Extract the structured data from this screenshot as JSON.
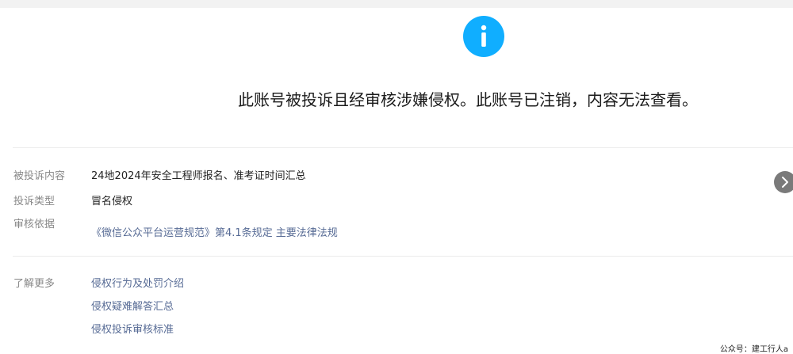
{
  "headline": "此账号被投诉且经审核涉嫌侵权。此账号已注销，内容无法查看。",
  "details": {
    "complaint_content_label": "被投诉内容",
    "complaint_content_value": "24地2024年安全工程师报名、准考证时间汇总",
    "complaint_type_label": "投诉类型",
    "complaint_type_value": "冒名侵权",
    "review_basis_label": "审核依据",
    "review_basis_link": "《微信公众平台运营规范》第4.1条规定 主要法律法规"
  },
  "learn_more": {
    "label": "了解更多",
    "links": [
      "侵权行为及处罚介绍",
      "侵权疑难解答汇总",
      "侵权投诉审核标准"
    ]
  },
  "footer": {
    "credit": "公众号：建工行人a"
  },
  "icons": {
    "info": "info-icon",
    "next": "chevron-right-icon"
  },
  "colors": {
    "info_blue": "#10aeff",
    "link": "#576b95",
    "label": "#888888"
  }
}
